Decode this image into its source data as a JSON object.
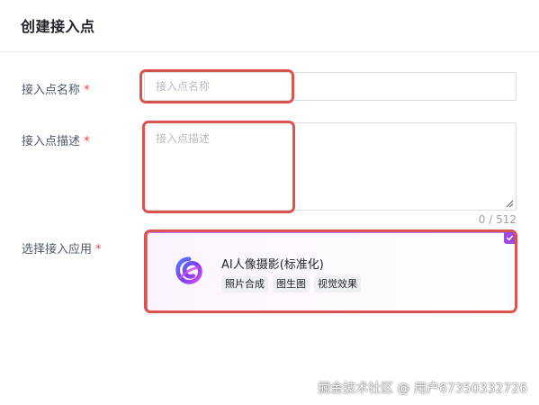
{
  "dialog": {
    "title": "创建接入点"
  },
  "form": {
    "name": {
      "label": "接入点名称",
      "required_mark": "*",
      "placeholder": "接入点名称",
      "value": ""
    },
    "description": {
      "label": "接入点描述",
      "required_mark": "*",
      "placeholder": "接入点描述",
      "value": "",
      "char_count": "0 / 512"
    },
    "app": {
      "label": "选择接入应用",
      "required_mark": "*",
      "selected_app": {
        "name": "AI人像摄影(标准化)",
        "tags": [
          "照片合成",
          "图生图",
          "视觉效果"
        ],
        "selected": true,
        "icon": "app-logo-icon"
      }
    }
  },
  "annotations": {
    "highlight_color": "#d9534f"
  },
  "colors": {
    "accent": "#9b4be2",
    "required": "#f53f3f"
  },
  "watermark": "掘金技术社区 @ 用户67350332726"
}
